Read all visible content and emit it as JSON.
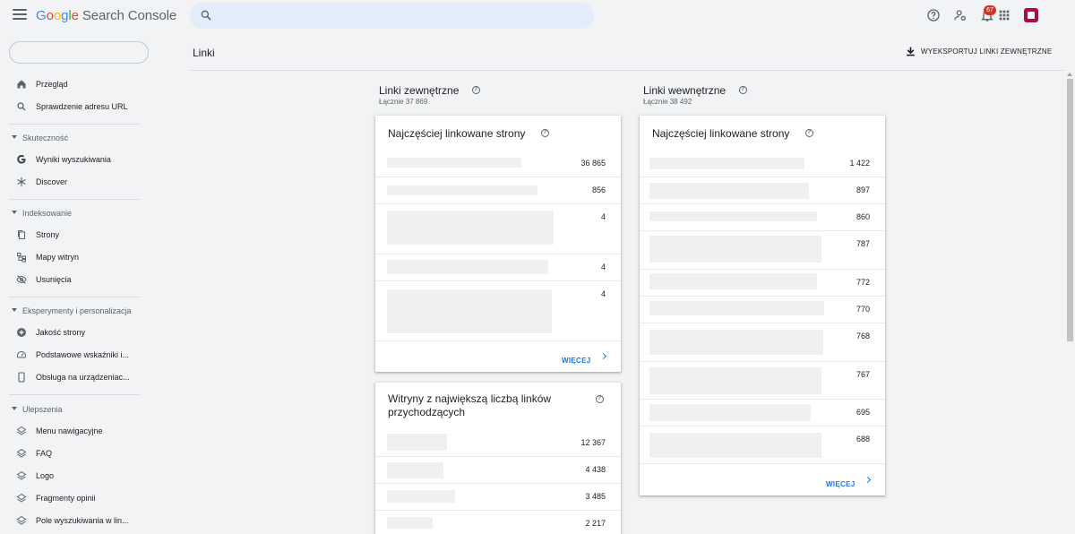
{
  "app": {
    "logo_letters": [
      "G",
      "o",
      "o",
      "g",
      "l",
      "e"
    ],
    "product": "Search Console",
    "notifications_count": "67"
  },
  "search": {
    "placeholder": ""
  },
  "sidebar": {
    "top_items": [
      {
        "label": "Przegląd",
        "icon": "home-icon"
      },
      {
        "label": "Sprawdzenie adresu URL",
        "icon": "search-icon"
      }
    ],
    "sections": [
      {
        "title": "Skuteczność",
        "items": [
          {
            "label": "Wyniki wyszukiwania",
            "icon": "google-g-icon"
          },
          {
            "label": "Discover",
            "icon": "asterisk-icon"
          }
        ]
      },
      {
        "title": "Indeksowanie",
        "items": [
          {
            "label": "Strony",
            "icon": "pages-icon"
          },
          {
            "label": "Mapy witryn",
            "icon": "sitemap-icon"
          },
          {
            "label": "Usunięcia",
            "icon": "eye-off-icon"
          }
        ]
      },
      {
        "title": "Eksperymenty i personalizacja",
        "items": [
          {
            "label": "Jakość strony",
            "icon": "plus-circle-icon"
          },
          {
            "label": "Podstawowe wskaźniki i...",
            "icon": "gauge-icon"
          },
          {
            "label": "Obsługa na urządzeniac...",
            "icon": "phone-icon"
          }
        ]
      },
      {
        "title": "Ulepszenia",
        "items": [
          {
            "label": "Menu nawigacyjne",
            "icon": "layers-icon"
          },
          {
            "label": "FAQ",
            "icon": "layers-icon"
          },
          {
            "label": "Logo",
            "icon": "layers-icon"
          },
          {
            "label": "Fragmenty opinii",
            "icon": "layers-icon"
          },
          {
            "label": "Pole wyszukiwania w lin...",
            "icon": "layers-icon"
          }
        ]
      }
    ]
  },
  "header": {
    "title": "Linki",
    "export_label": "WYEKSPORTUJ LINKI ZEWNĘTRZNE"
  },
  "external": {
    "title": "Linki zewnętrzne",
    "total": "Łącznie 37 869",
    "top_pages": {
      "title": "Najczęściej linkowane strony",
      "values": [
        "36 865",
        "856",
        "4",
        "4",
        "4"
      ],
      "more": "WIĘCEJ"
    },
    "top_sites": {
      "title": "Witryny z największą liczbą linków przychodzących",
      "values": [
        "12 367",
        "4 438",
        "3 485",
        "2 217"
      ]
    }
  },
  "internal": {
    "title": "Linki wewnętrzne",
    "total": "Łącznie 38 492",
    "top_pages": {
      "title": "Najczęściej linkowane strony",
      "values": [
        "1 422",
        "897",
        "860",
        "787",
        "772",
        "770",
        "768",
        "767",
        "695",
        "688"
      ],
      "more": "WIĘCEJ"
    }
  },
  "colors": {
    "accent": "#1a73e8",
    "badge": "#d93025",
    "app_icon": "#a50e4c"
  }
}
